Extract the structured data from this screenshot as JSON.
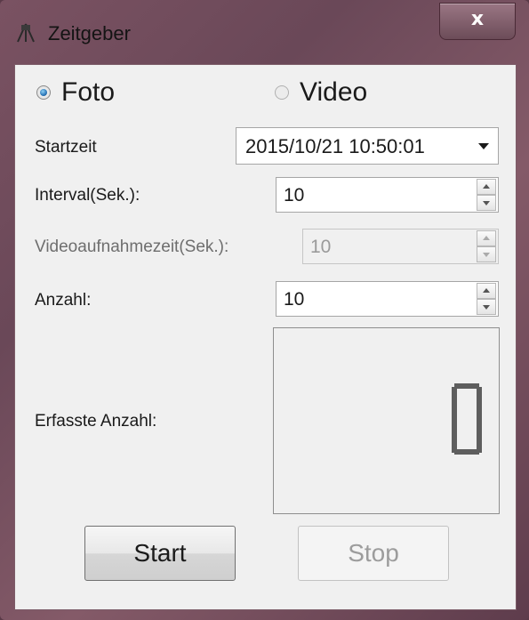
{
  "window": {
    "title": "Zeitgeber",
    "close_label": "x"
  },
  "mode": {
    "foto_label": "Foto",
    "video_label": "Video",
    "selected": "Foto"
  },
  "fields": {
    "startzeit_label": "Startzeit",
    "startzeit_value": "2015/10/21 10:50:01",
    "interval_label": "Interval(Sek.):",
    "interval_value": "10",
    "video_label": "Videoaufnahmezeit(Sek.):",
    "video_value": "10",
    "anzahl_label": "Anzahl:",
    "anzahl_value": "10",
    "erfasste_label": "Erfasste Anzahl:",
    "erfasste_value": "0"
  },
  "buttons": {
    "start_label": "Start",
    "stop_label": "Stop"
  },
  "icons": {
    "app": "camera-tripod-icon",
    "close": "close-icon",
    "dropdown": "chevron-down-icon"
  }
}
